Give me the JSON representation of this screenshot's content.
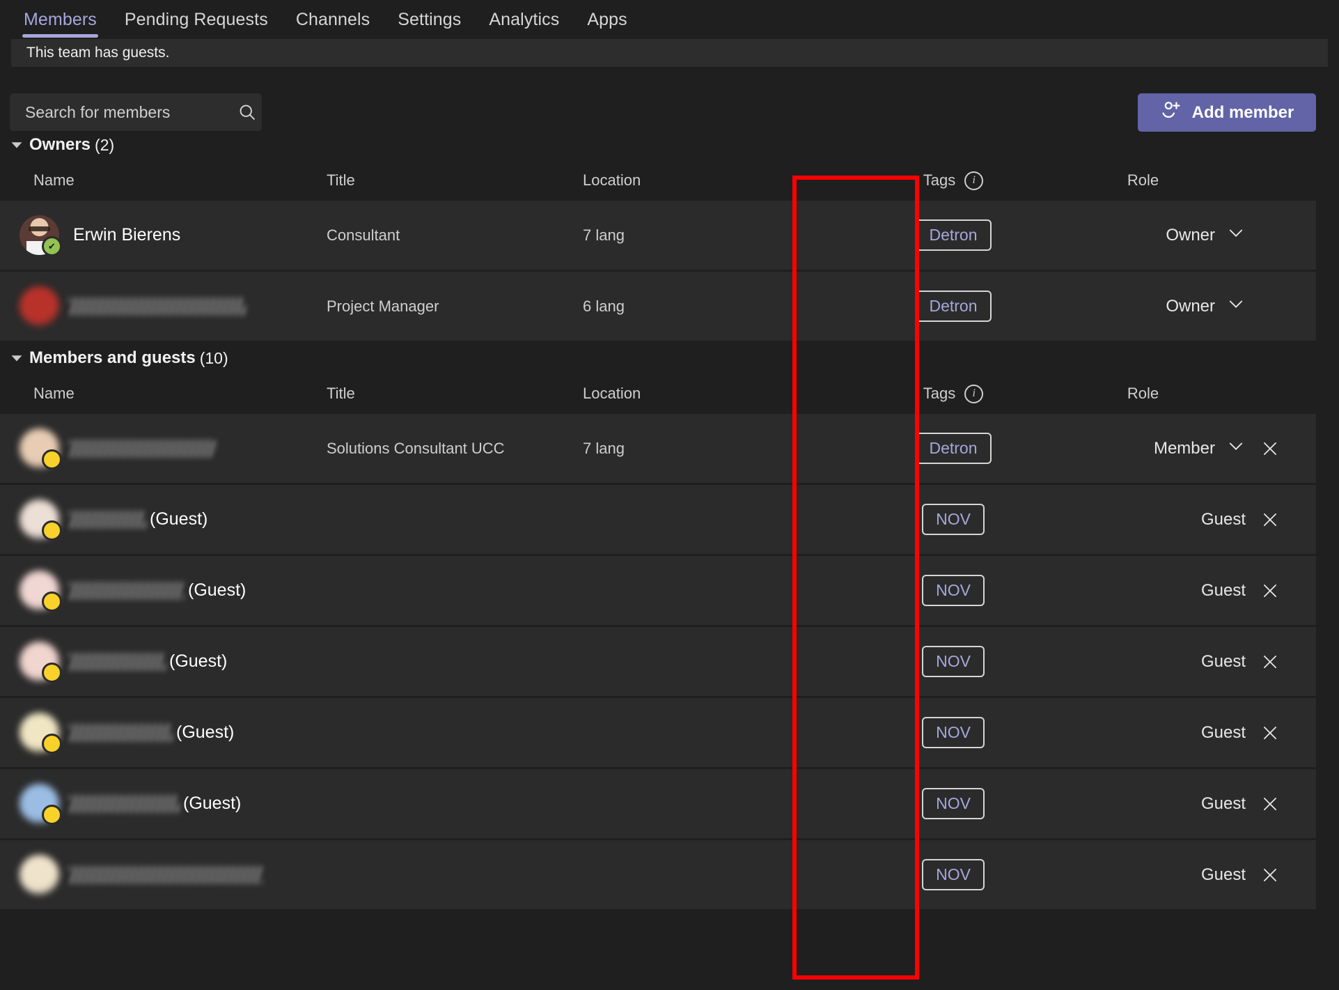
{
  "tabs": [
    {
      "label": "Members",
      "active": true
    },
    {
      "label": "Pending Requests",
      "active": false
    },
    {
      "label": "Channels",
      "active": false
    },
    {
      "label": "Settings",
      "active": false
    },
    {
      "label": "Analytics",
      "active": false
    },
    {
      "label": "Apps",
      "active": false
    }
  ],
  "banner": {
    "text": "This team has guests."
  },
  "search": {
    "placeholder": "Search for members",
    "value": "",
    "icon": "search-icon"
  },
  "add_member": {
    "label": "Add member",
    "icon": "person-add-icon"
  },
  "columns": {
    "name": "Name",
    "title": "Title",
    "location": "Location",
    "tags": "Tags",
    "tags_info_icon": "info-icon",
    "role": "Role"
  },
  "colors": {
    "accent": "#6264a7",
    "tag_text": "#a6a7dc",
    "active_tab": "#a6a7dc",
    "row_bg": "#2b2b2b",
    "page_bg": "#1f1f1f",
    "annotation": "#fe0000",
    "presence_available": "#92c353"
  },
  "sections": [
    {
      "title": "Owners",
      "count": "(2)",
      "expanded": true,
      "rows": [
        {
          "name": "Erwin Bierens",
          "redacted": false,
          "guest_suffix": "",
          "avatar": "photo-avatar",
          "presence": "available",
          "title": "Consultant",
          "location": "7 lang",
          "tag": "Detron",
          "role": "Owner",
          "role_dropdown": true,
          "removable": false
        },
        {
          "name": "",
          "redacted": true,
          "redacted_width": 253,
          "guest_suffix": "",
          "avatar": "redacted-avatar",
          "avatar_color": "#b8322a",
          "presence": "none",
          "title": "Project Manager",
          "location": "6 lang",
          "tag": "Detron",
          "role": "Owner",
          "role_dropdown": true,
          "removable": false
        }
      ]
    },
    {
      "title": "Members and guests",
      "count": "(10)",
      "expanded": true,
      "rows": [
        {
          "name": "",
          "redacted": true,
          "redacted_width": 210,
          "guest_suffix": "",
          "avatar": "redacted-avatar",
          "avatar_color": "#e8cdb4",
          "presence": "away",
          "title": "Solutions Consultant UCC",
          "location": "7 lang",
          "tag": "Detron",
          "role": "Member",
          "role_dropdown": true,
          "removable": true
        },
        {
          "name": "",
          "redacted": true,
          "redacted_width": 110,
          "guest_suffix": "(Guest)",
          "avatar": "redacted-avatar",
          "avatar_color": "#ecdfd6",
          "presence": "away",
          "title": "",
          "location": "",
          "tag": "NOV",
          "role": "Guest",
          "role_dropdown": false,
          "removable": true
        },
        {
          "name": "",
          "redacted": true,
          "redacted_width": 165,
          "guest_suffix": "(Guest)",
          "avatar": "redacted-avatar",
          "avatar_color": "#f0d7d3",
          "presence": "away",
          "title": "",
          "location": "",
          "tag": "NOV",
          "role": "Guest",
          "role_dropdown": false,
          "removable": true
        },
        {
          "name": "",
          "redacted": true,
          "redacted_width": 138,
          "guest_suffix": "(Guest)",
          "avatar": "redacted-avatar",
          "avatar_color": "#f1d5cf",
          "presence": "away",
          "title": "",
          "location": "",
          "tag": "NOV",
          "role": "Guest",
          "role_dropdown": false,
          "removable": true
        },
        {
          "name": "",
          "redacted": true,
          "redacted_width": 148,
          "guest_suffix": "(Guest)",
          "avatar": "redacted-avatar",
          "avatar_color": "#f0e6c4",
          "presence": "away",
          "title": "",
          "location": "",
          "tag": "NOV",
          "role": "Guest",
          "role_dropdown": false,
          "removable": true
        },
        {
          "name": "",
          "redacted": true,
          "redacted_width": 158,
          "guest_suffix": "(Guest)",
          "avatar": "redacted-avatar",
          "avatar_color": "#9bbde4",
          "presence": "away",
          "title": "",
          "location": "",
          "tag": "NOV",
          "role": "Guest",
          "role_dropdown": false,
          "removable": true
        },
        {
          "name": "",
          "redacted": true,
          "redacted_width": 278,
          "guest_suffix": "",
          "avatar": "redacted-avatar",
          "avatar_color": "#efe3cb",
          "presence": "none",
          "title": "",
          "location": "",
          "tag": "NOV",
          "role": "Guest",
          "role_dropdown": false,
          "removable": true
        }
      ]
    }
  ]
}
